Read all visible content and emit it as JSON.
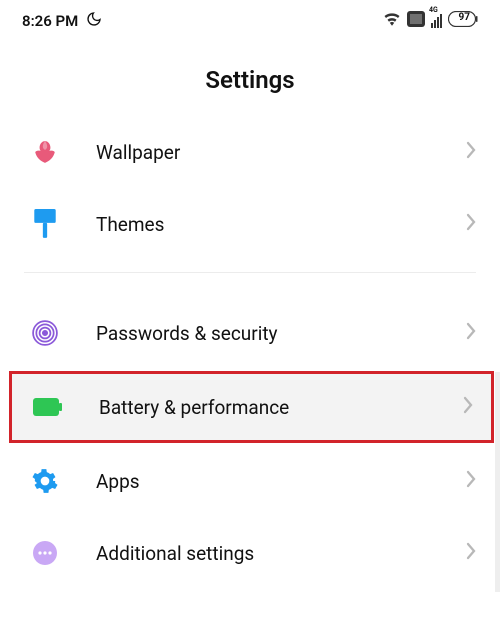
{
  "status": {
    "time": "8:26 PM",
    "battery": "97",
    "net": "4G"
  },
  "header": {
    "title": "Settings"
  },
  "items": {
    "wallpaper": {
      "label": "Wallpaper"
    },
    "themes": {
      "label": "Themes"
    },
    "passwords": {
      "label": "Passwords & security"
    },
    "battery": {
      "label": "Battery & performance"
    },
    "apps": {
      "label": "Apps"
    },
    "additional": {
      "label": "Additional settings"
    }
  }
}
